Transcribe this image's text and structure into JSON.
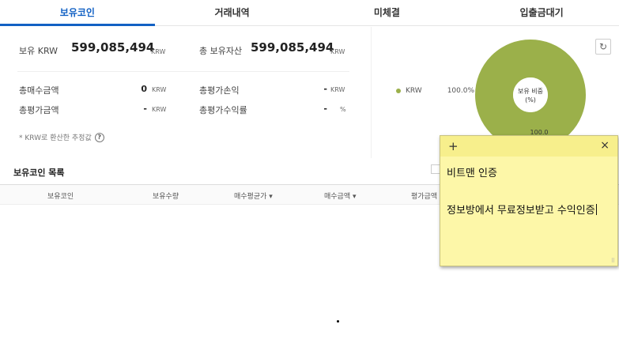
{
  "tabs": [
    "보유코인",
    "거래내역",
    "미체결",
    "입출금대기"
  ],
  "summary": {
    "holding_krw_label": "보유 KRW",
    "holding_krw_value": "599,085,494",
    "total_assets_label": "총 보유자산",
    "total_assets_value": "599,085,494",
    "unit_krw": "KRW",
    "unit_pct": "%",
    "total_buy_label": "총매수금액",
    "total_buy_value": "0",
    "total_pl_label": "총평가손익",
    "total_pl_value": "-",
    "total_eval_label": "총평가금액",
    "total_eval_value": "-",
    "total_return_label": "총평가수익률",
    "total_return_value": "-",
    "note": "* KRW로 환산한 추정값",
    "help_icon": "?"
  },
  "chart_data": {
    "type": "pie",
    "title": "보유 비중\n(%)",
    "center_label_line1": "보유 비중",
    "center_label_line2": "(%)",
    "categories": [
      "KRW"
    ],
    "values": [
      100.0
    ],
    "legend": [
      {
        "name": "KRW",
        "percent": "100.0%"
      }
    ],
    "slice_label": "100.0",
    "colors": [
      "#9bb04a"
    ]
  },
  "list": {
    "title": "보유코인 목록",
    "columns": [
      "보유코인",
      "보유수량",
      "매수평균가 ▾",
      "매수금액 ▾",
      "평가금액"
    ]
  },
  "sticky": {
    "line1": "비트맨 인증",
    "line2": "정보방에서 무료정보받고 수익인증"
  },
  "icons": {
    "refresh": "↻",
    "plus": "+",
    "close": "×",
    "grip": "⠿"
  }
}
